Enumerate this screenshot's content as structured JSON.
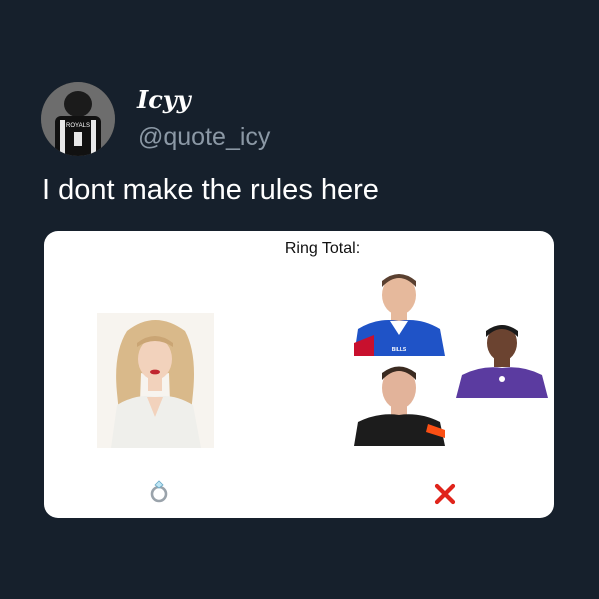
{
  "tweet": {
    "display_name": "Icyy",
    "handle": "@quote_icy",
    "text": "I dont make the rules here"
  },
  "media": {
    "title": "Ring Total:",
    "left_group": {
      "icon": "ring-icon"
    },
    "right_group": {
      "icon": "cross-icon",
      "icon_color": "#e0241b",
      "jersey_texts": [
        "BILLS"
      ]
    },
    "avatar_jersey_text": "ROYALS"
  },
  "colors": {
    "background": "#16202c",
    "handle": "#8b98a5",
    "bills_blue": "#1f53c7",
    "ravens_purple": "#5b3ba0",
    "bengals_black": "#1c1c1c"
  }
}
